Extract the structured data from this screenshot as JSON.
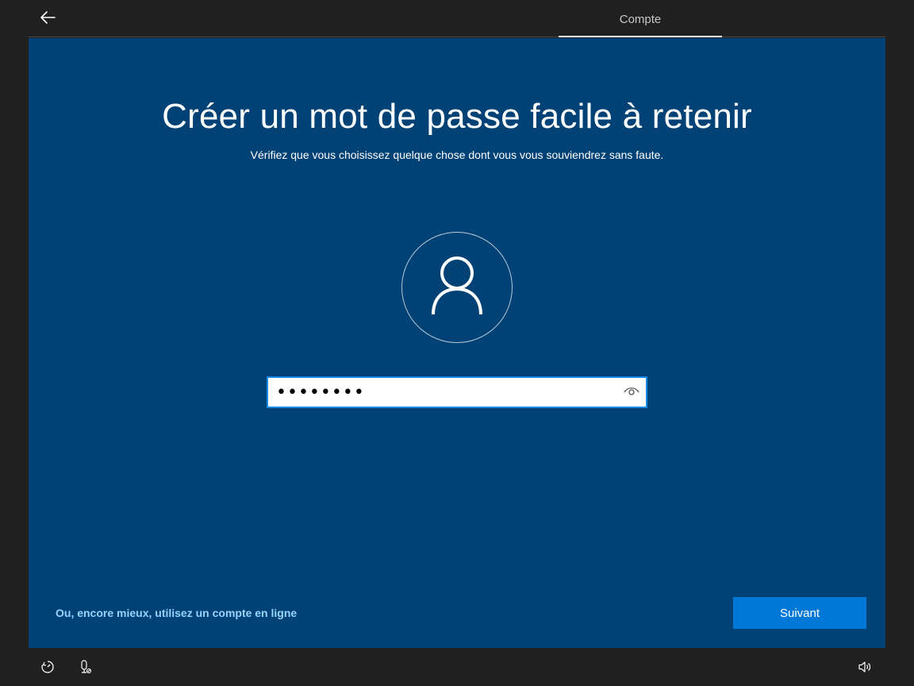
{
  "header": {
    "back_icon": "arrow-left-icon",
    "tab_label": "Compte"
  },
  "main": {
    "title": "Créer un mot de passe facile à retenir",
    "subtitle": "Vérifiez que vous choisissez quelque chose dont vous vous souviendrez sans faute.",
    "avatar_icon": "user-icon",
    "password": {
      "value": "••••••••",
      "reveal_icon": "eye-icon"
    },
    "online_account_link": "Ou, encore mieux, utilisez un compte en ligne",
    "next_button": "Suivant"
  },
  "footer": {
    "left_icons": [
      "ease-of-access-icon",
      "microphone-icon"
    ],
    "right_icon": "volume-icon"
  },
  "colors": {
    "panel_bg": "#004275",
    "frame_bg": "#202020",
    "accent": "#0078d7",
    "link": "#99d2ff"
  }
}
